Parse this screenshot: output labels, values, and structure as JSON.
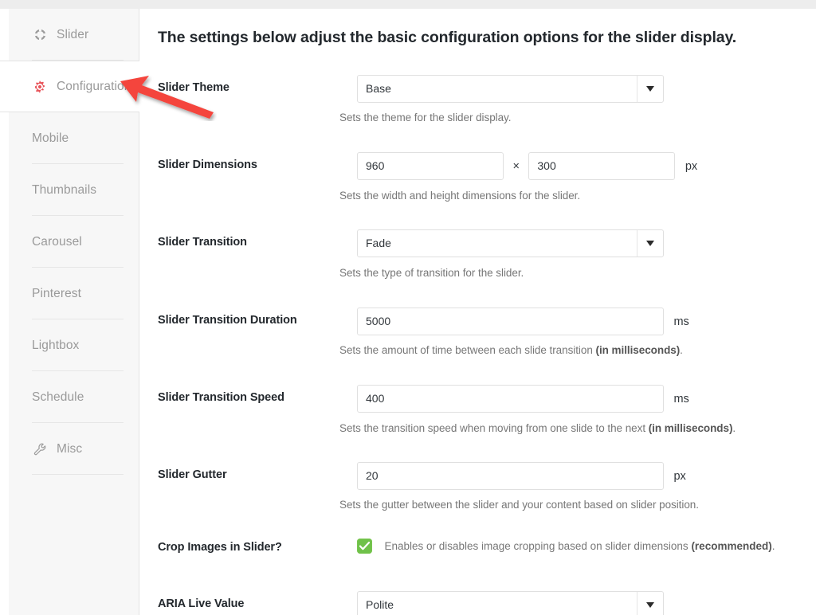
{
  "sidebar": {
    "items": [
      {
        "label": "Slider",
        "icon": "slider-ring-icon",
        "active": false
      },
      {
        "label": "Configuration",
        "icon": "gear-icon",
        "active": true
      },
      {
        "label": "Mobile",
        "icon": "",
        "active": false
      },
      {
        "label": "Thumbnails",
        "icon": "",
        "active": false
      },
      {
        "label": "Carousel",
        "icon": "",
        "active": false
      },
      {
        "label": "Pinterest",
        "icon": "",
        "active": false
      },
      {
        "label": "Lightbox",
        "icon": "",
        "active": false
      },
      {
        "label": "Schedule",
        "icon": "",
        "active": false
      },
      {
        "label": "Misc",
        "icon": "wrench-icon",
        "active": false
      }
    ]
  },
  "main": {
    "heading": "The settings below adjust the basic configuration options for the slider display.",
    "rows": {
      "theme": {
        "label": "Slider Theme",
        "value": "Base",
        "desc": "Sets the theme for the slider display."
      },
      "dimensions": {
        "label": "Slider Dimensions",
        "width": "960",
        "separator": "×",
        "height": "300",
        "unit": "px",
        "desc": "Sets the width and height dimensions for the slider."
      },
      "transition": {
        "label": "Slider Transition",
        "value": "Fade",
        "desc": "Sets the type of transition for the slider."
      },
      "duration": {
        "label": "Slider Transition Duration",
        "value": "5000",
        "unit": "ms",
        "desc_pre": "Sets the amount of time between each slide transition ",
        "desc_bold": "(in milliseconds)",
        "desc_post": "."
      },
      "speed": {
        "label": "Slider Transition Speed",
        "value": "400",
        "unit": "ms",
        "desc_pre": "Sets the transition speed when moving from one slide to the next ",
        "desc_bold": "(in milliseconds)",
        "desc_post": "."
      },
      "gutter": {
        "label": "Slider Gutter",
        "value": "20",
        "unit": "px",
        "desc": "Sets the gutter between the slider and your content based on slider position."
      },
      "crop": {
        "label": "Crop Images in Slider?",
        "checked": true,
        "desc_pre": "Enables or disables image cropping based on slider dimensions ",
        "desc_bold": "(recommended)",
        "desc_post": "."
      },
      "aria": {
        "label": "ARIA Live Value",
        "value": "Polite"
      }
    }
  },
  "annotation": {
    "arrow": "red-arrow-pointing-to-configuration",
    "color": "#f4453c"
  },
  "colors": {
    "accent_red": "#e8545a",
    "checkbox_green": "#6fc14a",
    "sidebar_bg": "#f7f7f7",
    "text_dark": "#23282d",
    "text_muted": "#777777",
    "nav_label": "#9a9a9a"
  }
}
